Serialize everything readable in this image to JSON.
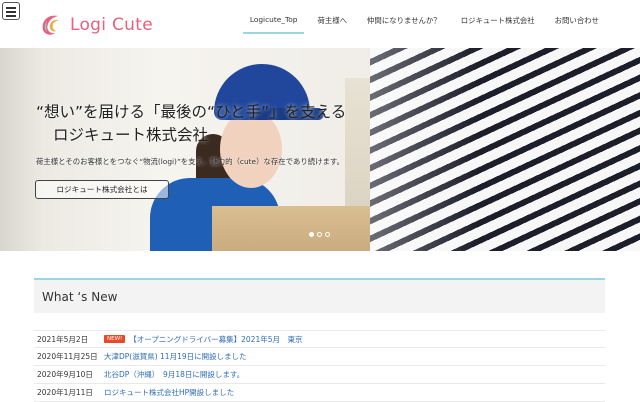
{
  "header": {
    "logo_text": "Logi Cute",
    "nav": [
      {
        "label": "Logicute_Top",
        "active": true
      },
      {
        "label": "荷主様へ",
        "active": false
      },
      {
        "label": "仲間になりませんか？",
        "active": false
      },
      {
        "label": "ロジキュート株式会社",
        "active": false
      },
      {
        "label": "お問い合わせ",
        "active": false
      }
    ]
  },
  "hero": {
    "title_line1": "“想い”を届ける「最後の“ひと手”」を支える",
    "title_line2": "ロジキュート株式会社",
    "subtitle": "荷主様とそのお客様とをつなぐ“物流(logi)”を支え、魅力的（cute）な存在であり続けます。",
    "button_label": "ロジキュート株式会社とは",
    "next_arrow": "›",
    "slides": 3,
    "active_slide": 1
  },
  "news": {
    "heading": "What ‘s New",
    "items": [
      {
        "date": "2021年5月2日",
        "badge": "NEW!",
        "title": "【オープニングドライバー募集】2021年5月　東京"
      },
      {
        "date": "2020年11月25日",
        "badge": "",
        "title": "大津DP(滋賀県) 11月19日に開設しました"
      },
      {
        "date": "2020年9月10日",
        "badge": "",
        "title": "北谷DP（沖縄）　9月18日に開設します。"
      },
      {
        "date": "2020年1月11日",
        "badge": "",
        "title": "ロジキュート株式会社HP開設しました"
      }
    ]
  },
  "colors": {
    "brand": "#e8607d",
    "accent_line": "#9ad6e3",
    "link": "#2e6db8",
    "badge": "#e8492b"
  }
}
